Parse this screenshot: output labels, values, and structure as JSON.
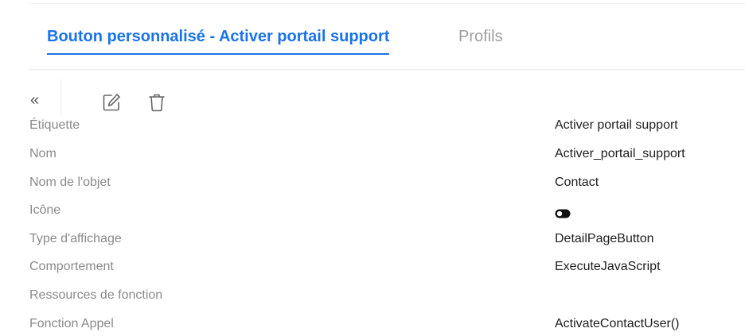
{
  "tabs": [
    {
      "label": "Bouton personnalisé - Activer portail support",
      "active": true
    },
    {
      "label": "Profils",
      "active": false
    }
  ],
  "toolbar": {
    "collapse_glyph": "«",
    "edit_icon": "edit-icon",
    "delete_icon": "trash-icon"
  },
  "fields": [
    {
      "label": "Étiquette",
      "value": "Activer portail support"
    },
    {
      "label": "Nom",
      "value": "Activer_portail_support"
    },
    {
      "label": "Nom de l'objet",
      "value": "Contact"
    },
    {
      "label": "Icône",
      "value": "",
      "icon": "toggle-icon"
    },
    {
      "label": "Type d'affichage",
      "value": "DetailPageButton"
    },
    {
      "label": "Comportement",
      "value": "ExecuteJavaScript"
    },
    {
      "label": "Ressources de fonction",
      "value": ""
    },
    {
      "label": "Fonction Appel",
      "value": "ActivateContactUser()"
    }
  ],
  "colors": {
    "accent": "#1a73e8",
    "label": "#8a8a8a",
    "value": "#202020"
  }
}
